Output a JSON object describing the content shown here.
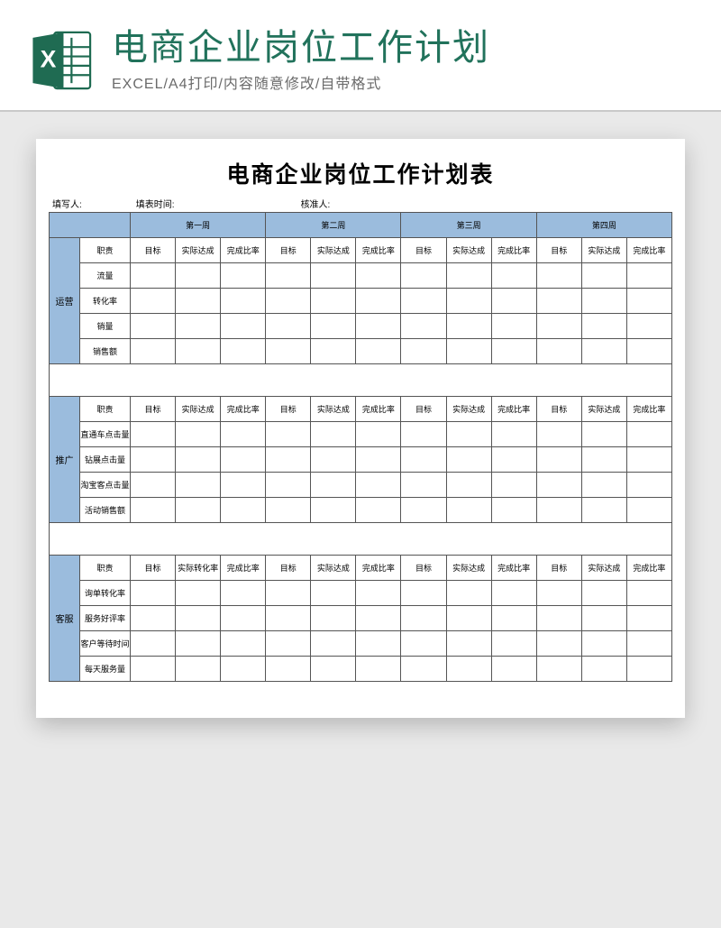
{
  "header": {
    "title": "电商企业岗位工作计划",
    "subtitle": "EXCEL/A4打印/内容随意修改/自带格式",
    "icon_name": "excel-icon"
  },
  "doc": {
    "title": "电商企业岗位工作计划表",
    "meta": {
      "writer_label": "填写人:",
      "time_label": "填表时间:",
      "approver_label": "核准人:"
    },
    "weeks": [
      "第一周",
      "第二周",
      "第三周",
      "第四周"
    ],
    "sub_headers_default": [
      "目标",
      "实际达成",
      "完成比率"
    ],
    "sub_headers_kf_week1": [
      "目标",
      "实际转化率",
      "完成比率"
    ],
    "label_col_header": "职责",
    "sections": [
      {
        "name": "运营",
        "metrics": [
          "流量",
          "转化率",
          "销量",
          "销售额"
        ]
      },
      {
        "name": "推广",
        "metrics": [
          "直通车点击量",
          "钻展点击量",
          "淘宝客点击量",
          "活动销售额"
        ]
      },
      {
        "name": "客服",
        "metrics": [
          "询单转化率",
          "服务好评率",
          "客户等待时间",
          "每天服务量"
        ]
      }
    ]
  }
}
